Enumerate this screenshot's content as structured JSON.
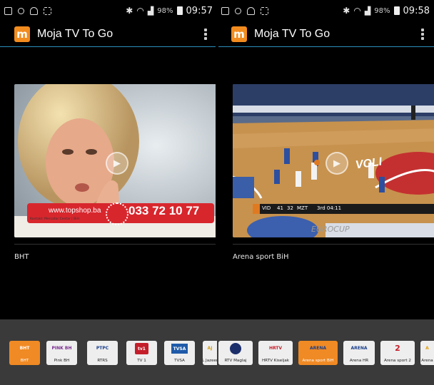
{
  "left": {
    "status": {
      "battery_pct": "98%",
      "time": "09:57"
    },
    "app_title": "Moja TV To Go",
    "video": {
      "overlay_url": "www.topshop.ba",
      "overlay_phone": "033 72 10 77",
      "overlay_small": "Kontakt: Mercator Centar | BiH"
    },
    "channel_label": "BHT"
  },
  "right": {
    "status": {
      "battery_pct": "98%",
      "time": "09:58"
    },
    "app_title": "Moja TV To Go",
    "video": {
      "banner": "VOLI",
      "score_a": "41",
      "score_b": "32",
      "period": "3rd 04:11",
      "league": "EUROCUP"
    },
    "channel_label": "Arena sport BiH"
  },
  "strip": {
    "channels": [
      {
        "name": "BHT",
        "logo_text": "BHT",
        "active": true
      },
      {
        "name": "Pink BH",
        "logo_text": "PINK BH"
      },
      {
        "name": "RTRS",
        "logo_text": "РТРС"
      },
      {
        "name": "TV 1",
        "logo_text": "tv1"
      },
      {
        "name": "TVSA",
        "logo_text": "TVSA"
      },
      {
        "name": "AL Jazeera",
        "logo_text": "AJ"
      },
      {
        "name": "RTV Maglaj",
        "logo_text": "RTV"
      },
      {
        "name": "HRTV Kiseljak",
        "logo_text": "HRTV"
      },
      {
        "name": "Arena sport BiH",
        "logo_text": "ARENA",
        "active": true
      },
      {
        "name": "Arena HR",
        "logo_text": "ARENA"
      },
      {
        "name": "Arena sport 2",
        "logo_text": "2"
      },
      {
        "name": "Arena",
        "logo_text": "A"
      }
    ]
  },
  "colors": {
    "accent": "#f08a24",
    "appbar_line": "#2a8fbd",
    "strip_bg": "#3a3a3a"
  }
}
